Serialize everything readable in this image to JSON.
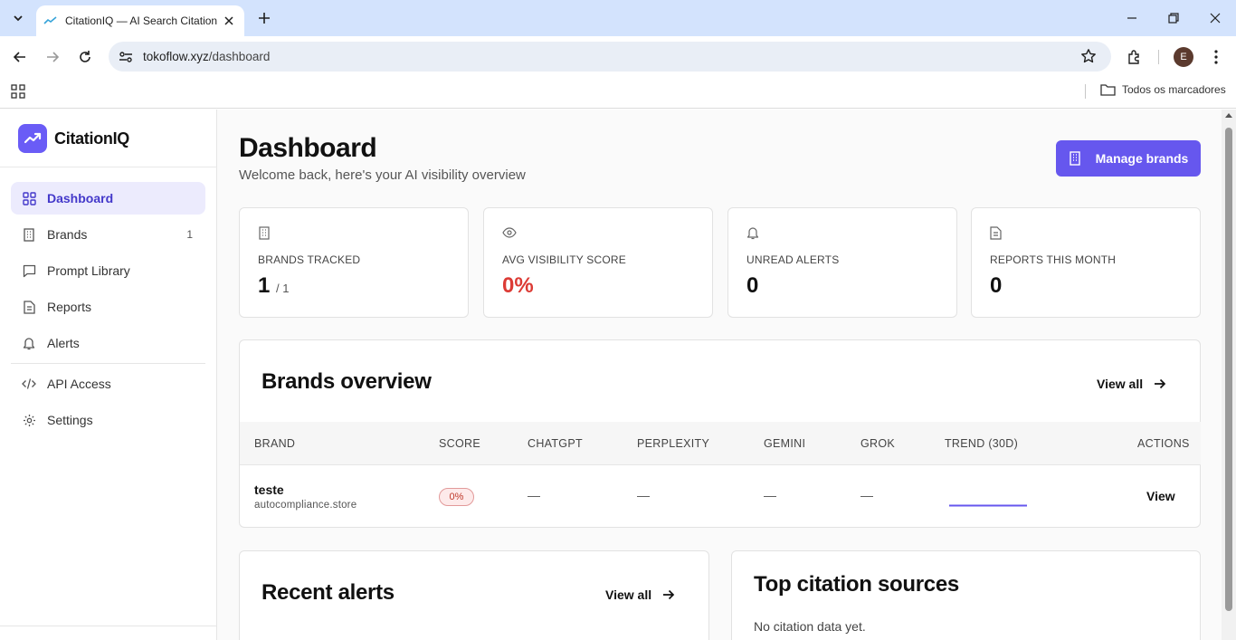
{
  "browser": {
    "tab_title": "CitationIQ — AI Search Citation Tracker",
    "url_host": "tokoflow.xyz",
    "url_path": "/dashboard",
    "profile_initial": "E",
    "bookmarks_all_label": "Todos os marcadores"
  },
  "sidebar": {
    "brand_name": "CitationIQ",
    "items": [
      {
        "label": "Dashboard",
        "icon": "grid-icon",
        "active": true
      },
      {
        "label": "Brands",
        "icon": "building-icon",
        "count": "1"
      },
      {
        "label": "Prompt Library",
        "icon": "chat-icon"
      },
      {
        "label": "Reports",
        "icon": "document-icon"
      },
      {
        "label": "Alerts",
        "icon": "bell-icon"
      },
      {
        "label": "API Access",
        "icon": "code-icon"
      },
      {
        "label": "Settings",
        "icon": "gear-icon"
      }
    ]
  },
  "header": {
    "title": "Dashboard",
    "subtitle": "Welcome back, here's your AI visibility overview",
    "manage_button": "Manage brands"
  },
  "stats": [
    {
      "label": "BRANDS TRACKED",
      "value": "1",
      "suffix": "/ 1",
      "icon": "building-icon"
    },
    {
      "label": "AVG VISIBILITY SCORE",
      "value": "0%",
      "icon": "eye-icon",
      "color": "#dc3b35"
    },
    {
      "label": "UNREAD ALERTS",
      "value": "0",
      "icon": "bell-icon"
    },
    {
      "label": "REPORTS THIS MONTH",
      "value": "0",
      "icon": "document-icon"
    }
  ],
  "brands_overview": {
    "title": "Brands overview",
    "view_all": "View all",
    "columns": [
      "BRAND",
      "SCORE",
      "CHATGPT",
      "PERPLEXITY",
      "GEMINI",
      "GROK",
      "TREND (30D)",
      "ACTIONS"
    ],
    "rows": [
      {
        "name": "teste",
        "domain": "autocompliance.store",
        "score": "0%",
        "chatgpt": "—",
        "perplexity": "—",
        "gemini": "—",
        "grok": "—",
        "action": "View"
      }
    ]
  },
  "recent_alerts": {
    "title": "Recent alerts",
    "view_all": "View all"
  },
  "top_sources": {
    "title": "Top citation sources",
    "empty": "No citation data yet."
  },
  "colors": {
    "accent": "#6657ee",
    "active_bg": "#ecebfd",
    "danger": "#dc3b35"
  }
}
